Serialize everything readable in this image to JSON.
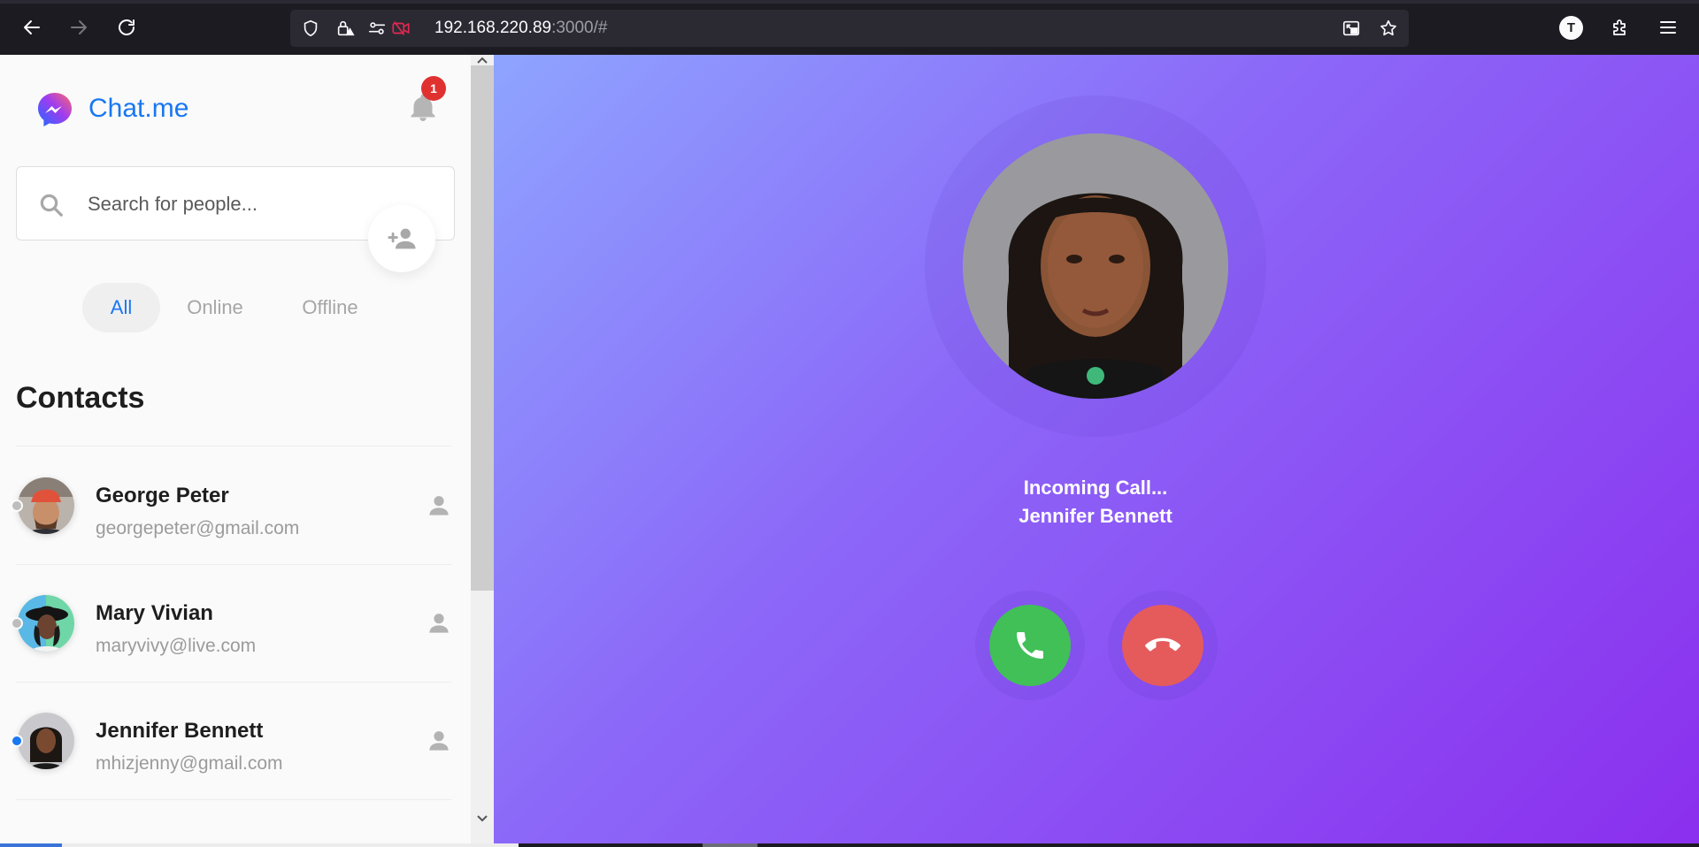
{
  "browser": {
    "url_host": "192.168.220.89",
    "url_rest": ":3000/#",
    "profile_initial": "T",
    "icons": [
      "back-arrow-icon",
      "forward-arrow-icon",
      "reload-icon",
      "shield-icon",
      "lock-warning-icon",
      "permissions-icon",
      "camera-blocked-icon",
      "picture-in-picture-icon",
      "bookmark-star-icon",
      "extensions-icon",
      "menu-icon"
    ]
  },
  "sidebar": {
    "brand": "Chat.me",
    "notification_count": "1",
    "search_placeholder": "Search for people...",
    "tabs": [
      {
        "label": "All",
        "active": true
      },
      {
        "label": "Online",
        "active": false
      },
      {
        "label": "Offline",
        "active": false
      }
    ],
    "section_title": "Contacts",
    "contacts": [
      {
        "name": "George Peter",
        "email": "georgepeter@gmail.com",
        "status": "offline",
        "status_color": "#bdbdbd"
      },
      {
        "name": "Mary Vivian",
        "email": "maryvivy@live.com",
        "status": "offline",
        "status_color": "#bdbdbd"
      },
      {
        "name": "Jennifer Bennett",
        "email": "mhizjenny@gmail.com",
        "status": "online",
        "status_color": "#1877f2"
      }
    ]
  },
  "call": {
    "status": "Incoming Call...",
    "caller_name": "Jennifer Bennett",
    "accept_color": "#40c057",
    "decline_color": "#e55b5b"
  },
  "colors": {
    "brand": "#1877f2",
    "badge": "#e03131",
    "gradient_start": "#8ea4ff",
    "gradient_end": "#8b2fee"
  }
}
